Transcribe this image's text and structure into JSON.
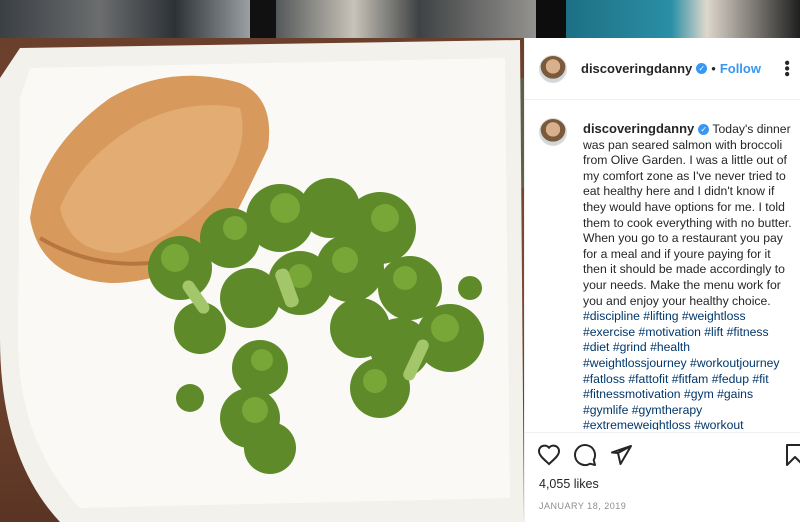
{
  "post": {
    "username": "discoveringdanny",
    "verified_icon": "✓",
    "separator": "•",
    "follow_label": "Follow",
    "more_icon": "•••",
    "caption_text": "Today's dinner was pan seared salmon with broccoli from Olive Garden. I was a little out of my comfort zone as I've never tried to eat healthy here and I didn't know if they would have options for me. I told them to cook everything with no butter. When you go to a restaurant you pay for a meal and if youre paying for it then it should be made accordingly to your needs. Make the menu work for you and enjoy your healthy choice.",
    "hashtags": "#discipline #lifting #weightloss #exercise #motivation #lift #fitness #diet #grind #health #weightlossjourney #workoutjourney #fatloss #fattofit #fitfam #fedup #fit #fitnessmotivation #gym #gains #gymlife #gymtherapy #extremeweightloss #workout",
    "likes": "4,055 likes",
    "date": "JANUARY 18, 2019"
  },
  "icons": {
    "like": "heart-icon",
    "comment": "comment-icon",
    "share": "share-icon",
    "save": "bookmark-icon"
  },
  "colors": {
    "link": "#3897f0",
    "hashtag": "#00376b",
    "text": "#262626",
    "muted": "#8e8e8e"
  }
}
